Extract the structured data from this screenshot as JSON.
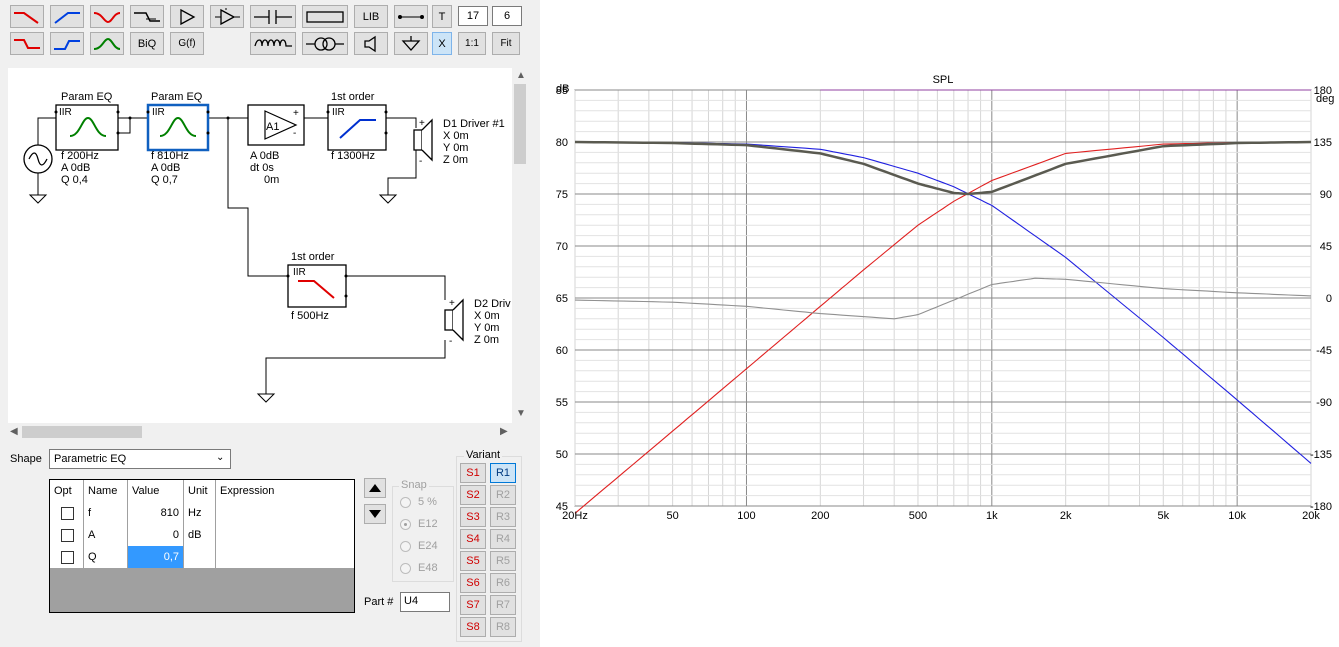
{
  "toolbar": {
    "lib_label": "LIB",
    "t_label": "T",
    "biq_label": "BiQ",
    "gf_label": "G(f)",
    "ratio_label": "1:1",
    "fit_label": "Fit",
    "x_label": "X",
    "field1_value": "17",
    "field2_value": "6"
  },
  "schematic": {
    "block1": {
      "title": "Param EQ",
      "type": "IIR",
      "line1": "f  200Hz",
      "line2": "A  0dB",
      "line3": "Q 0,4"
    },
    "block2": {
      "title": "Param EQ",
      "type": "IIR",
      "line1": "f  810Hz",
      "line2": "A  0dB",
      "line3": "Q 0,7"
    },
    "amp": {
      "name": "A1",
      "line1": "A  0dB",
      "line2": "dt 0s",
      "line3": "0m",
      "plus": "+",
      "minus": "-"
    },
    "hp": {
      "title": "1st order",
      "type": "IIR",
      "line1": "f  1300Hz"
    },
    "lp": {
      "title": "1st order",
      "type": "IIR",
      "line1": "f  500Hz"
    },
    "driver1": {
      "name": "D1 Driver #1",
      "x": "X 0m",
      "y": "Y 0m",
      "z": "Z 0m",
      "plus": "+",
      "minus": "-"
    },
    "driver2": {
      "name": "D2 Driv",
      "x": "X 0m",
      "y": "Y 0m",
      "z": "Z 0m",
      "plus": "+",
      "minus": "-"
    }
  },
  "shape": {
    "label": "Shape",
    "value": "Parametric EQ"
  },
  "params": {
    "headers": {
      "opt": "Opt",
      "name": "Name",
      "value": "Value",
      "unit": "Unit",
      "expression": "Expression"
    },
    "rows": [
      {
        "name": "f",
        "value": "810",
        "unit": "Hz"
      },
      {
        "name": "A",
        "value": "0",
        "unit": "dB"
      },
      {
        "name": "Q",
        "value": "0,7",
        "unit": ""
      }
    ]
  },
  "snap": {
    "label": "Snap",
    "options": [
      "5 %",
      "E12",
      "E24",
      "E48"
    ],
    "selected": "E12"
  },
  "part": {
    "label": "Part #",
    "value": "U4"
  },
  "variant": {
    "label": "Variant",
    "s": [
      "S1",
      "S2",
      "S3",
      "S4",
      "S5",
      "S6",
      "S7",
      "S8"
    ],
    "r": [
      "R1",
      "R2",
      "R3",
      "R4",
      "R5",
      "R6",
      "R7",
      "R8"
    ],
    "selected_r": "R1"
  },
  "chart_data": {
    "type": "line",
    "title": "SPL",
    "xlabel": "",
    "ylabel_left": "dB",
    "ylabel_right": "deg",
    "x_scale": "log",
    "xlim": [
      20,
      20000
    ],
    "ylim": [
      45,
      85
    ],
    "ylim_right": [
      -180,
      180
    ],
    "x_ticks": [
      "20Hz",
      "50",
      "100",
      "200",
      "500",
      "1k",
      "2k",
      "5k",
      "10k",
      "20k"
    ],
    "y_ticks": [
      "85",
      "80",
      "75",
      "70",
      "65",
      "60",
      "55",
      "50",
      "45"
    ],
    "y_ticks_right": [
      "180",
      "135",
      "90",
      "45",
      "0",
      "-45",
      "-90",
      "-135",
      "-180"
    ],
    "grid": true,
    "colors": {
      "lowpass": "#2020e0",
      "highpass": "#e02020",
      "sum": "#5a5a50",
      "phase": "#909090",
      "limit": "#9040a0"
    },
    "series": [
      {
        "color": "#2020e0",
        "x": [
          20,
          50,
          100,
          200,
          300,
          500,
          700,
          1000,
          2000,
          5000,
          10000,
          20000
        ],
        "y": [
          80,
          79.95,
          79.8,
          79.3,
          78.5,
          77.0,
          75.7,
          73.9,
          68.9,
          61.2,
          55.2,
          49.1
        ]
      },
      {
        "color": "#e02020",
        "x": [
          20,
          50,
          100,
          200,
          300,
          500,
          700,
          1000,
          2000,
          5000,
          10000,
          20000
        ],
        "y": [
          44.3,
          52.2,
          58.2,
          64.2,
          67.7,
          72.0,
          74.3,
          76.3,
          78.9,
          79.8,
          79.95,
          80
        ]
      },
      {
        "color": "#5a5a50",
        "x": [
          20,
          50,
          100,
          200,
          300,
          500,
          700,
          800,
          1000,
          2000,
          5000,
          10000,
          20000
        ],
        "y": [
          80,
          79.9,
          79.7,
          78.9,
          77.9,
          76.0,
          75.1,
          75.0,
          75.2,
          77.9,
          79.6,
          79.9,
          80
        ]
      },
      {
        "color": "#909090",
        "x": [
          20,
          50,
          100,
          200,
          400,
          500,
          700,
          1000,
          1500,
          2000,
          5000,
          10000,
          20000
        ],
        "y": [
          64.8,
          64.6,
          64.2,
          63.5,
          63.0,
          63.4,
          64.8,
          66.3,
          66.9,
          66.8,
          65.9,
          65.5,
          65.2
        ]
      },
      {
        "color": "#9040a0",
        "x": [
          200,
          20000
        ],
        "y": [
          85,
          85
        ]
      }
    ]
  }
}
